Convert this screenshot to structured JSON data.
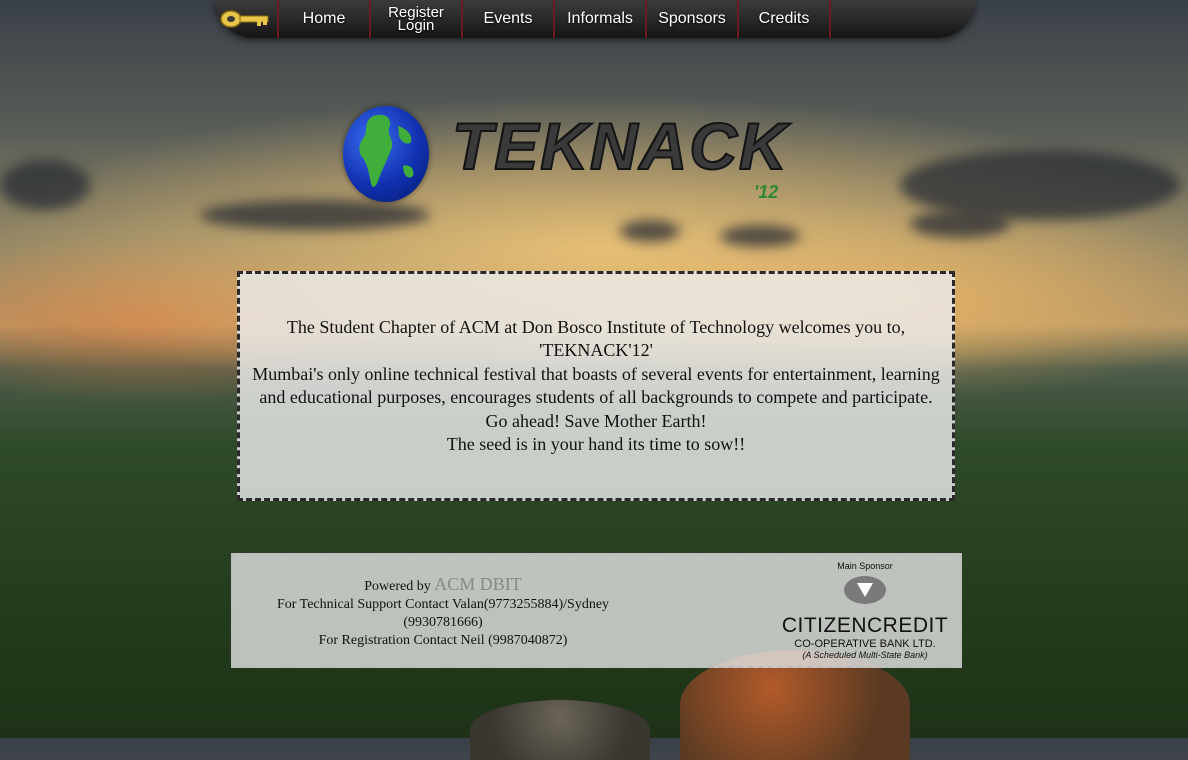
{
  "nav": {
    "items": [
      {
        "label": "Home"
      },
      {
        "label_top": "Register",
        "label_bottom": "Login"
      },
      {
        "label": "Events"
      },
      {
        "label": "Informals"
      },
      {
        "label": "Sponsors"
      },
      {
        "label": "Credits"
      }
    ]
  },
  "logo": {
    "text": "TEKNACK",
    "year": "'12"
  },
  "welcome": {
    "line1": "The Student Chapter of ACM at Don Bosco Institute of Technology welcomes you to,",
    "line2": "'TEKNACK'12'",
    "line3": "Mumbai's only online technical festival that boasts of several events for entertainment, learning and educational purposes, encourages students of all backgrounds to compete and participate.",
    "line4": "Go ahead! Save Mother Earth!",
    "line5": "The seed is in your hand its time to sow!!"
  },
  "footer": {
    "powered_prefix": "Powered by",
    "powered_name": "ACM DBIT",
    "tech_support": "For Technical Support Contact Valan(9773255884)/Sydney (9930781666)",
    "registration": "For Registration Contact Neil (9987040872)",
    "sponsor_label": "Main Sponsor",
    "sponsor_name": "CITIZENCREDIT",
    "sponsor_sub": "CO-OPERATIVE BANK LTD.",
    "sponsor_tag": "(A Scheduled Multi-State Bank)"
  }
}
